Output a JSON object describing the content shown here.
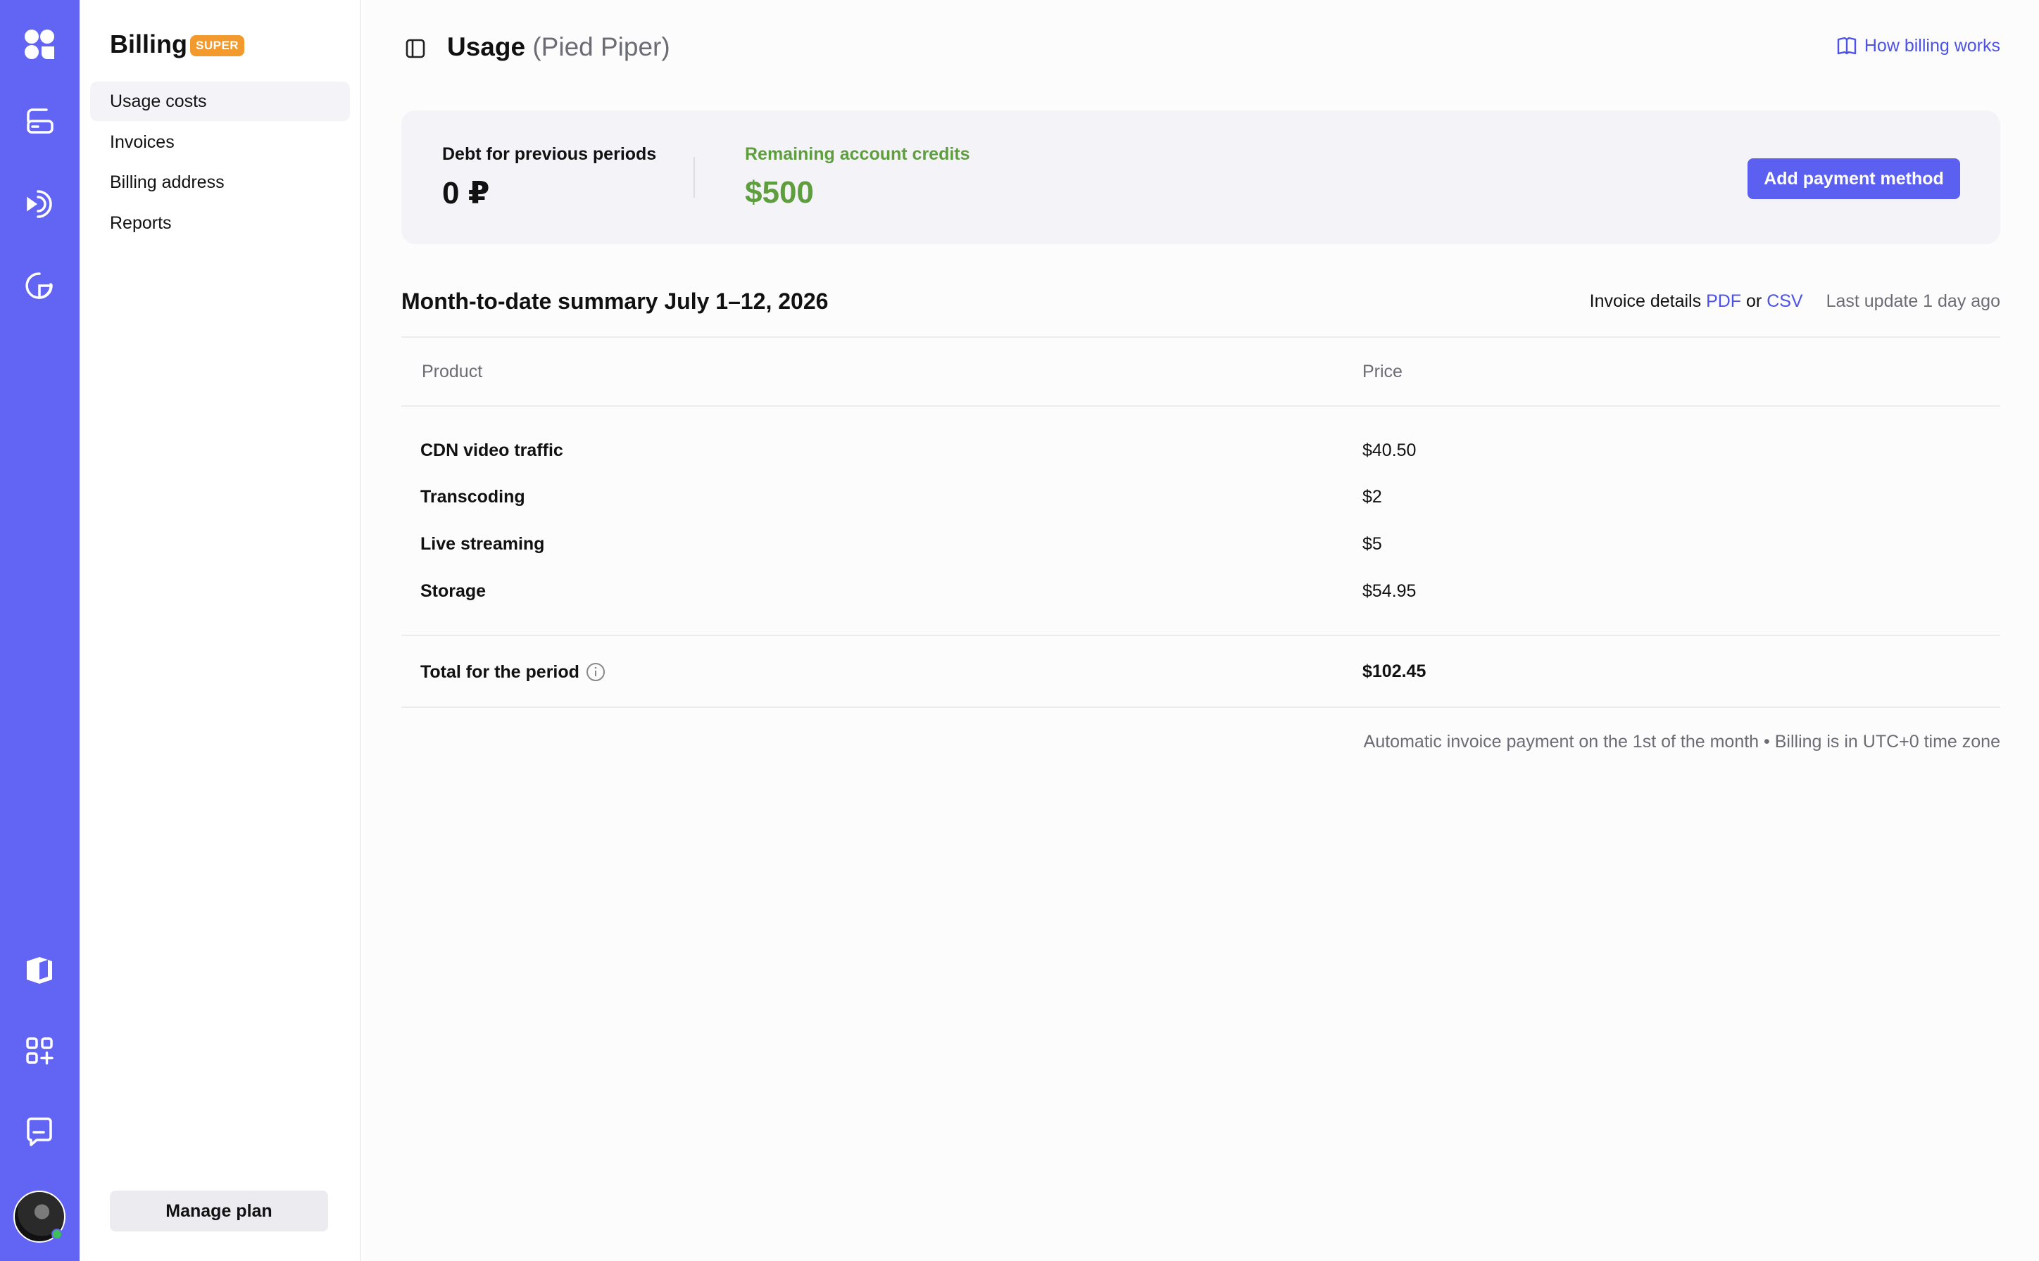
{
  "rail": {
    "icons": [
      "logo-icon",
      "hosting-icon",
      "streaming-icon",
      "analytics-icon",
      "docs-icon",
      "apps-icon",
      "chat-icon"
    ],
    "accent": "#6264f4"
  },
  "sidebar": {
    "title": "Billing",
    "badge": "SUPER",
    "items": [
      {
        "label": "Usage costs",
        "active": true
      },
      {
        "label": "Invoices",
        "active": false
      },
      {
        "label": "Billing address",
        "active": false
      },
      {
        "label": "Reports",
        "active": false
      }
    ],
    "manage_plan": "Manage plan"
  },
  "header": {
    "title": "Usage",
    "org": "(Pied Piper)",
    "help_link": "How billing works"
  },
  "balance": {
    "debt_label": "Debt for previous periods",
    "debt_value": "0 ₽",
    "credits_label": "Remaining account credits",
    "credits_value": "$500",
    "add_payment": "Add payment method"
  },
  "summary": {
    "title": "Month-to-date summary July 1–12, 2026",
    "invoice_details": "Invoice details",
    "pdf": "PDF",
    "or": "or",
    "csv": "CSV",
    "last_update": "Last update 1 day ago",
    "columns": [
      "Product",
      "Price"
    ],
    "rows": [
      {
        "product": "CDN video traffic",
        "price": "$40.50"
      },
      {
        "product": "Transcoding",
        "price": "$2"
      },
      {
        "product": "Live streaming",
        "price": "$5"
      },
      {
        "product": "Storage",
        "price": "$54.95"
      }
    ],
    "total_label": "Total for the period",
    "total_value": "$102.45",
    "footnote": "Automatic invoice payment on the 1st of the month • Billing is in UTC+0 time zone"
  },
  "colors": {
    "brand": "#6264f4",
    "button": "#5b60f0",
    "link": "#4b53e6",
    "credits": "#5e9e3e",
    "badge": "#f29a2e"
  }
}
